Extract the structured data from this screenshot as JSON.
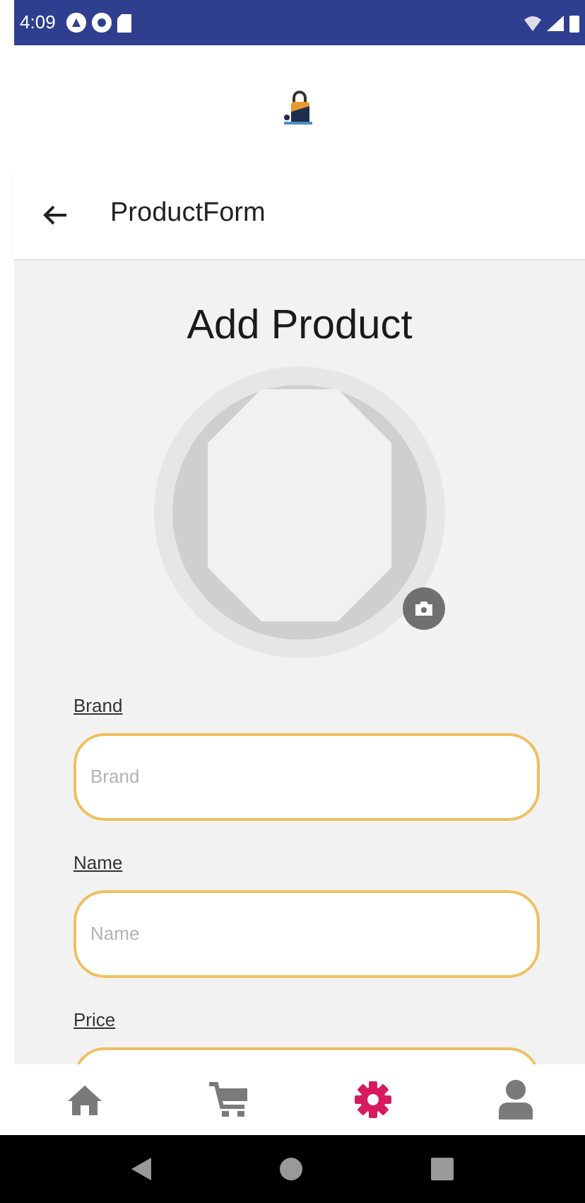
{
  "status_bar": {
    "time": "4:09"
  },
  "header": {
    "title": "ProductForm"
  },
  "page_title": "Add Product",
  "fields": [
    {
      "label": "Brand",
      "placeholder": "Brand"
    },
    {
      "label": "Name",
      "placeholder": "Name"
    },
    {
      "label": "Price"
    }
  ],
  "bottom_nav": [
    {
      "kind": "home",
      "selected": false
    },
    {
      "kind": "cart",
      "selected": false
    },
    {
      "kind": "settings",
      "selected": true
    },
    {
      "kind": "profile",
      "selected": false
    }
  ]
}
